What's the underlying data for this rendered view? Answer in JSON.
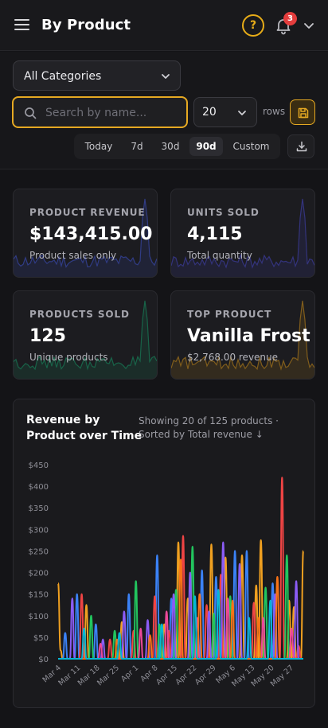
{
  "header": {
    "title": "By Product",
    "help_label": "?",
    "notification_count": "3"
  },
  "filters": {
    "category": "All Categories",
    "search_placeholder": "Search by name...",
    "rows_value": "20",
    "rows_label": "rows",
    "ranges": [
      "Today",
      "7d",
      "30d",
      "90d",
      "Custom"
    ],
    "active_range": "90d"
  },
  "stats": [
    {
      "label": "PRODUCT REVENUE",
      "value": "$143,415.00",
      "sub": "Product sales only",
      "color": "#3b4bb3"
    },
    {
      "label": "UNITS SOLD",
      "value": "4,115",
      "sub": "Total quantity",
      "color": "#3f3fa8"
    },
    {
      "label": "PRODUCTS SOLD",
      "value": "125",
      "sub": "Unique products",
      "color": "#17865c"
    },
    {
      "label": "TOP PRODUCT",
      "value": "Vanilla Frost",
      "sub": "$2,768.00 revenue",
      "color": "#b07c1a"
    }
  ],
  "chart": {
    "title": "Revenue by Product over Time",
    "subtitle": "Showing 20 of 125 products · Sorted by Total revenue ↓"
  },
  "chart_data": {
    "type": "line",
    "ylim": [
      0,
      450
    ],
    "yticks": [
      "$0",
      "$50",
      "$100",
      "$150",
      "$200",
      "$250",
      "$300",
      "$350",
      "$400",
      "$450"
    ],
    "xticks": [
      "Mar 4",
      "Mar 11",
      "Mar 18",
      "Mar 25",
      "Apr 1",
      "Apr 8",
      "Apr 15",
      "Apr 22",
      "Apr 29",
      "May 6",
      "May 13",
      "May 20",
      "May 27"
    ],
    "grid": false,
    "series": [
      {
        "color": "#f0a020",
        "points": [
          [
            0,
            175
          ],
          [
            1,
            20
          ],
          [
            12,
            125
          ],
          [
            27,
            85
          ],
          [
            45,
            80
          ],
          [
            51,
            270
          ],
          [
            55,
            140
          ],
          [
            65,
            265
          ],
          [
            71,
            235
          ],
          [
            78,
            240
          ],
          [
            84,
            170
          ],
          [
            86,
            275
          ],
          [
            98,
            135
          ],
          [
            100,
            120
          ],
          [
            104,
            250
          ]
        ]
      },
      {
        "color": "#3b82f6",
        "points": [
          [
            3,
            60
          ],
          [
            8,
            150
          ],
          [
            16,
            80
          ],
          [
            30,
            150
          ],
          [
            42,
            240
          ],
          [
            48,
            140
          ],
          [
            61,
            205
          ],
          [
            67,
            190
          ],
          [
            75,
            250
          ],
          [
            80,
            250
          ],
          [
            91,
            175
          ]
        ]
      },
      {
        "color": "#ef4444",
        "points": [
          [
            10,
            150
          ],
          [
            22,
            45
          ],
          [
            32,
            65
          ],
          [
            41,
            145
          ],
          [
            47,
            65
          ],
          [
            53,
            285
          ],
          [
            63,
            125
          ],
          [
            69,
            195
          ],
          [
            83,
            130
          ],
          [
            95,
            420
          ],
          [
            102,
            30
          ]
        ]
      },
      {
        "color": "#22c55e",
        "points": [
          [
            14,
            100
          ],
          [
            24,
            65
          ],
          [
            33,
            180
          ],
          [
            43,
            80
          ],
          [
            50,
            160
          ],
          [
            57,
            260
          ],
          [
            66,
            105
          ],
          [
            73,
            145
          ],
          [
            88,
            165
          ],
          [
            97,
            240
          ]
        ]
      },
      {
        "color": "#8b5cf6",
        "points": [
          [
            6,
            140
          ],
          [
            19,
            45
          ],
          [
            28,
            110
          ],
          [
            38,
            90
          ],
          [
            49,
            150
          ],
          [
            56,
            200
          ],
          [
            64,
            110
          ],
          [
            70,
            270
          ],
          [
            77,
            220
          ],
          [
            92,
            150
          ],
          [
            101,
            180
          ]
        ]
      },
      {
        "color": "#ec4899",
        "points": [
          [
            18,
            35
          ],
          [
            35,
            70
          ],
          [
            46,
            110
          ],
          [
            59,
            95
          ],
          [
            72,
            140
          ],
          [
            87,
            95
          ],
          [
            99,
            70
          ]
        ]
      },
      {
        "color": "#f97316",
        "points": [
          [
            25,
            45
          ],
          [
            39,
            55
          ],
          [
            52,
            230
          ],
          [
            60,
            150
          ],
          [
            74,
            135
          ],
          [
            85,
            95
          ],
          [
            93,
            190
          ]
        ]
      },
      {
        "color": "#06b6d4",
        "points": [
          [
            11,
            70
          ],
          [
            26,
            60
          ],
          [
            44,
            80
          ],
          [
            58,
            145
          ],
          [
            68,
            160
          ],
          [
            81,
            95
          ],
          [
            90,
            135
          ]
        ]
      }
    ]
  }
}
